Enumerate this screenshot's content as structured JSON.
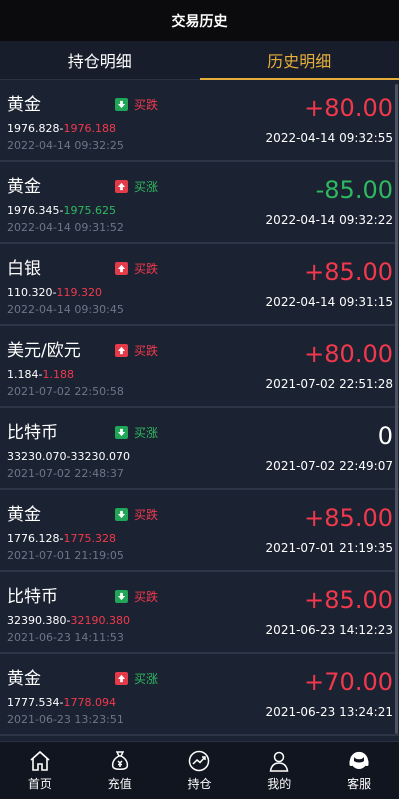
{
  "header": {
    "title": "交易历史"
  },
  "tabs": [
    {
      "label": "持仓明细",
      "active": false
    },
    {
      "label": "历史明细",
      "active": true
    }
  ],
  "rows": [
    {
      "name": "黄金",
      "direction": "买跌",
      "dir_type": "down",
      "open": "1976.828",
      "close": "1976.188",
      "close_color": "red",
      "open_time": "2022-04-14 09:32:25",
      "pnl": "+80.00",
      "pnl_color": "red",
      "close_time": "2022-04-14 09:32:55"
    },
    {
      "name": "黄金",
      "direction": "买涨",
      "dir_type": "up",
      "open": "1976.345",
      "close": "1975.625",
      "close_color": "green",
      "open_time": "2022-04-14 09:31:52",
      "pnl": "-85.00",
      "pnl_color": "green",
      "close_time": "2022-04-14 09:32:22"
    },
    {
      "name": "白银",
      "direction": "买跌",
      "dir_type": "up",
      "open": "110.320",
      "close": "119.320",
      "close_color": "red",
      "open_time": "2022-04-14 09:30:45",
      "pnl": "+85.00",
      "pnl_color": "red",
      "close_time": "2022-04-14 09:31:15"
    },
    {
      "name": "美元/欧元",
      "direction": "买跌",
      "dir_type": "up",
      "open": "1.184",
      "close": "1.188",
      "close_color": "red",
      "open_time": "2021-07-02 22:50:58",
      "pnl": "+80.00",
      "pnl_color": "red",
      "close_time": "2021-07-02 22:51:28"
    },
    {
      "name": "比特币",
      "direction": "买涨",
      "dir_type": "down",
      "open": "33230.070",
      "close": "33230.070",
      "close_color": "white",
      "open_time": "2021-07-02 22:48:37",
      "pnl": "0",
      "pnl_color": "white",
      "close_time": "2021-07-02 22:49:07"
    },
    {
      "name": "黄金",
      "direction": "买跌",
      "dir_type": "down",
      "open": "1776.128",
      "close": "1775.328",
      "close_color": "red",
      "open_time": "2021-07-01 21:19:05",
      "pnl": "+85.00",
      "pnl_color": "red",
      "close_time": "2021-07-01 21:19:35"
    },
    {
      "name": "比特币",
      "direction": "买跌",
      "dir_type": "down",
      "open": "32390.380",
      "close": "32190.380",
      "close_color": "red",
      "open_time": "2021-06-23 14:11:53",
      "pnl": "+85.00",
      "pnl_color": "red",
      "close_time": "2021-06-23 14:12:23"
    },
    {
      "name": "黄金",
      "direction": "买涨",
      "dir_type": "up",
      "open": "1777.534",
      "close": "1778.094",
      "close_color": "red",
      "open_time": "2021-06-23 13:23:51",
      "pnl": "+70.00",
      "pnl_color": "red",
      "close_time": "2021-06-23 13:24:21"
    }
  ],
  "nav": [
    {
      "label": "首页",
      "icon": "home-icon"
    },
    {
      "label": "充值",
      "icon": "money-bag-icon"
    },
    {
      "label": "持仓",
      "icon": "chart-icon"
    },
    {
      "label": "我的",
      "icon": "user-icon"
    },
    {
      "label": "客服",
      "icon": "headset-icon"
    }
  ],
  "colors": {
    "red": "#f2394c",
    "green": "#2fb95f",
    "gold": "#e6ae3a",
    "bg": "#1b2232"
  }
}
